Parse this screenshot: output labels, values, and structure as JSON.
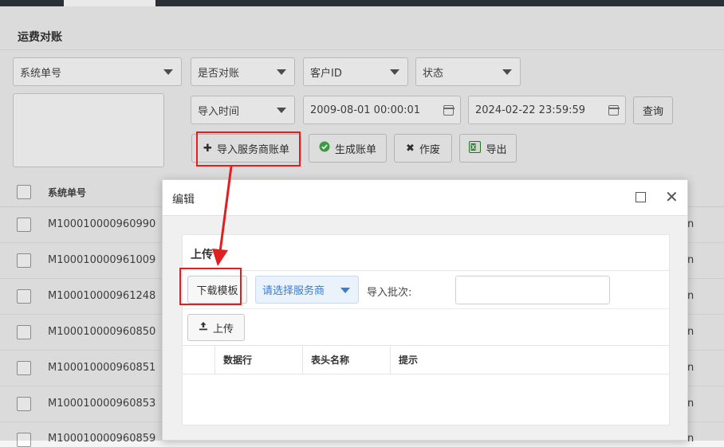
{
  "page": {
    "title": "运费对账"
  },
  "filters": {
    "system_no": "系统单号",
    "reconciled": "是否对账",
    "customer_id": "客户ID",
    "status": "状态",
    "import_time": "导入时间",
    "date_from": "2009-08-01 00:00:01",
    "date_to": "2024-02-22 23:59:59",
    "query_label": "查询"
  },
  "toolbar": {
    "import_label": "导入服务商账单",
    "generate_label": "生成账单",
    "void_label": "作废",
    "export_label": "导出"
  },
  "table": {
    "header_no": "系统单号",
    "rows": [
      {
        "id": "M100010000960990",
        "tail": "n"
      },
      {
        "id": "M100010000961009",
        "tail": "n"
      },
      {
        "id": "M100010000961248",
        "tail": "n"
      },
      {
        "id": "M100010000960850",
        "tail": "n"
      },
      {
        "id": "M100010000960851",
        "tail": "n"
      },
      {
        "id": "M100010000960853",
        "tail": "n"
      },
      {
        "id": "M100010000960859",
        "tail": "n"
      }
    ]
  },
  "modal": {
    "title": "编辑",
    "section_title": "上传",
    "download_template_label": "下载模板",
    "provider_placeholder": "请选择服务商",
    "batch_label": "导入批次:",
    "batch_value": "",
    "upload_label": "上传",
    "columns": [
      "数据行",
      "表头名称",
      "提示"
    ]
  },
  "colors": {
    "annotation": "#e02020",
    "provider_select": "#3a7bd5"
  },
  "icons": [
    "plus-icon",
    "check-circle-icon",
    "x-icon",
    "excel-icon",
    "upload-icon",
    "calendar-icon",
    "maximize-icon",
    "close-icon"
  ]
}
